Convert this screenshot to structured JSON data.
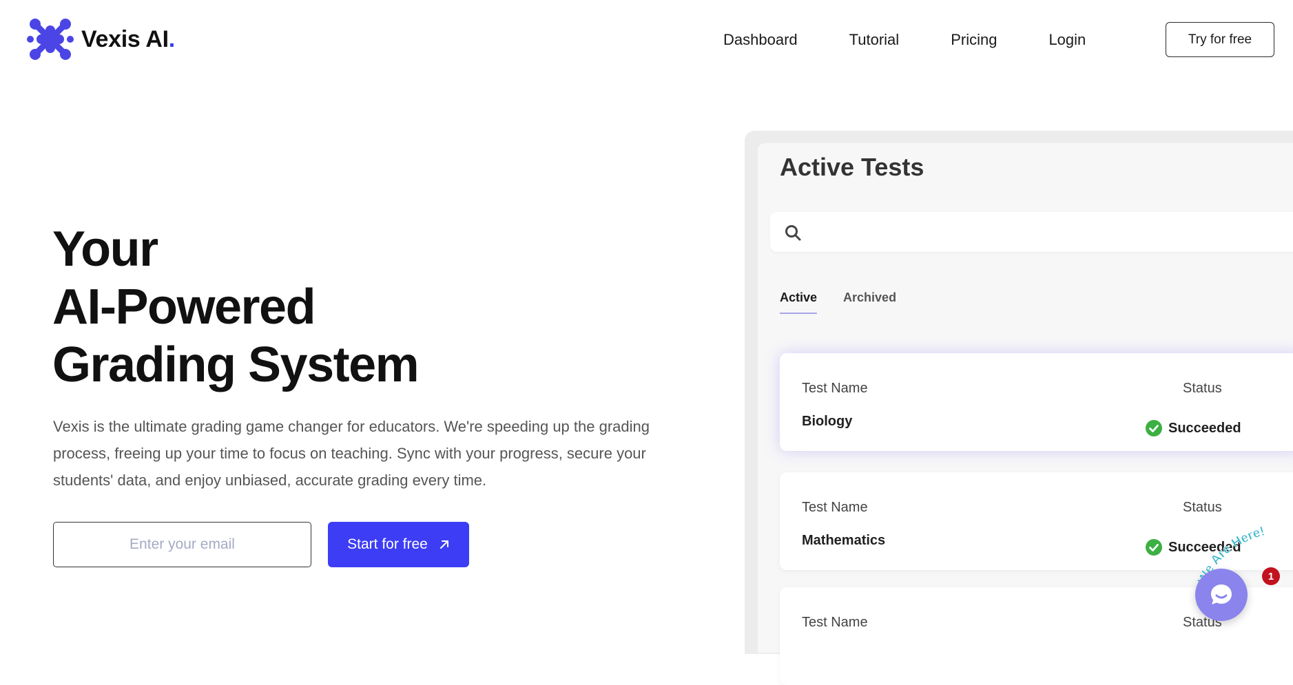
{
  "header": {
    "logo_text": "Vexis AI",
    "logo_dot": ".",
    "nav": [
      "Dashboard",
      "Tutorial",
      "Pricing",
      "Login"
    ],
    "cta_label": "Try for free"
  },
  "hero": {
    "title_lines": [
      "Your",
      "AI-Powered",
      "Grading System"
    ],
    "description": "Vexis is the ultimate grading game changer for educators. We're speeding up the grading process, freeing up your time to focus on teaching. Sync with your progress, secure your students' data, and enjoy unbiased, accurate grading every time.",
    "email_placeholder": "Enter your email",
    "start_label": "Start for free"
  },
  "dashboard": {
    "title": "Active Tests",
    "tabs": [
      {
        "label": "Active",
        "active": true
      },
      {
        "label": "Archived",
        "active": false
      }
    ],
    "cards": [
      {
        "name_label": "Test Name",
        "status_label": "Status",
        "name": "Biology",
        "status": "Succeeded"
      },
      {
        "name_label": "Test Name",
        "status_label": "Status",
        "name": "Mathematics",
        "status": "Succeeded"
      },
      {
        "name_label": "Test Name",
        "status_label": "Status",
        "name": "",
        "status": ""
      }
    ]
  },
  "chat": {
    "badge_count": "1",
    "wave_text": "We Are Here!"
  },
  "colors": {
    "brand": "#3d3df5",
    "logo": "#4b45e6",
    "success": "#3cb043",
    "chat": "#8a84ec",
    "badge": "#c1121f"
  },
  "icons": {
    "search": "search-icon",
    "check": "check-circle-icon",
    "arrow": "arrow-up-right-icon",
    "chat": "chat-bubble-icon",
    "wave": "waving-hand-icon"
  }
}
